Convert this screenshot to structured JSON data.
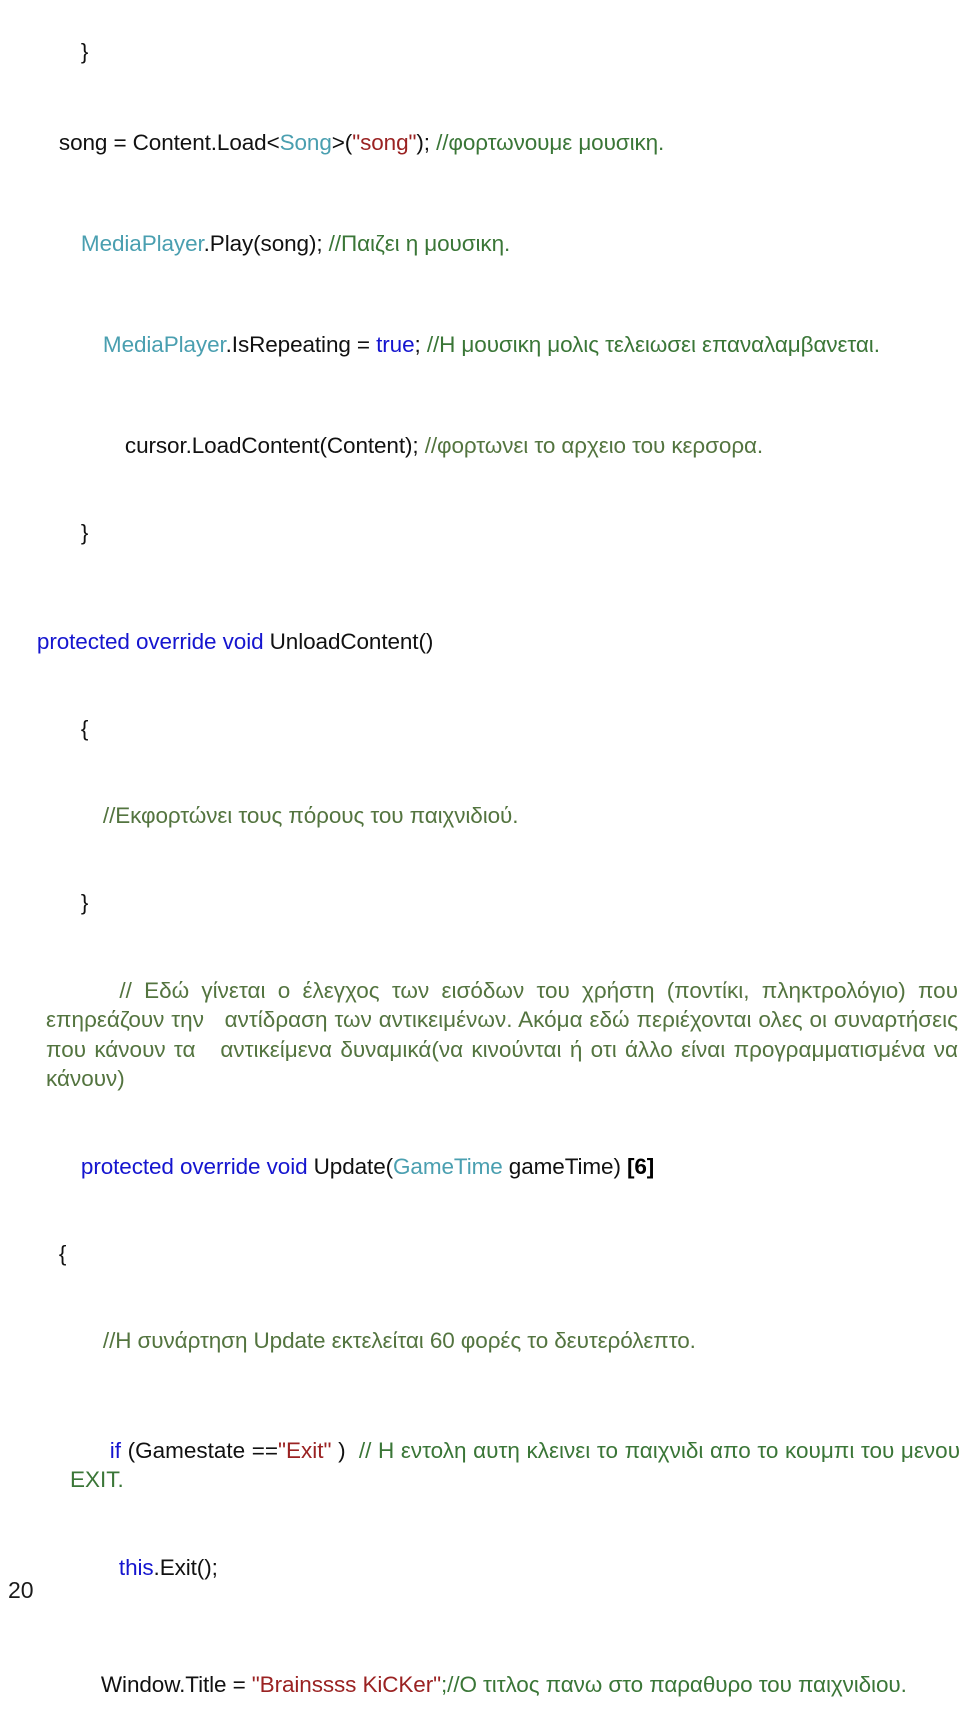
{
  "document": {
    "page_number": "20",
    "language": "C# (XNA) with Greek comments"
  },
  "colors": {
    "keyword": "#1515cf",
    "type": "#4a9fb0",
    "string": "#9a2222",
    "comment": "#3a7637",
    "comment_olive": "#53743f",
    "plain": "#111111",
    "background": "#ffffff"
  },
  "code": {
    "l01_brace_close": "}",
    "l02_a": "song = Content.Load<",
    "l02_b": "Song",
    "l02_c": ">(",
    "l02_d": "\"song\"",
    "l02_e": "); ",
    "l02_f": "//φορτωνουμε μουσικη.",
    "l03_a": "MediaPlayer",
    "l03_b": ".Play(song); ",
    "l03_c": "//Παιζει η μουσικη.",
    "l04_a": "MediaPlayer",
    "l04_b": ".IsRepeating = ",
    "l04_c": "true",
    "l04_d": "; ",
    "l04_e": "//Η μουσικη μολις τελειωσει επαναλαμβανεται.",
    "l05_a": "cursor.LoadContent(Content); ",
    "l05_b": "//φορτωνει το αρχειο του κερσορα.",
    "l06_brace_close": "}",
    "l07_a": "protected override void ",
    "l07_b": "UnloadContent()",
    "l08_brace_open": "{",
    "l09_comment": "//Εκφορτώνει τους πόρους του παιχνιδιού.",
    "l10_brace_close": "}",
    "l11_comment_block": "// Εδώ γίνεται ο έλεγχος των εισόδων του χρήστη (ποντίκι, πληκτρολόγιο) που επηρεάζουν την   αντίδραση των αντικειμένων. Ακόμα εδώ περιέχονται ολες οι συναρτήσεις που κάνουν τα   αντικείμενα δυναμικά(να κινούνται ή οτι άλλο είναι προγραμματισμένα να κάνουν)",
    "l12_a": "protected override void ",
    "l12_b": "Update(",
    "l12_c": "GameTime",
    "l12_d": " gameTime) ",
    "l12_e": "[6]",
    "l13_brace_open": "{",
    "l14_comment": "//Η συνάρτηση Update εκτελείται 60 φορές το δευτερόλεπτο.",
    "l15_a": "if ",
    "l15_b": "(Gamestate ==",
    "l15_c": "\"Exit\"",
    "l15_d": " )  ",
    "l15_e": "// Η εντολη αυτη κλεινει το παιχνιδι απο το κουμπι του μενου EXIT.",
    "l16_a": "this",
    "l16_b": ".Exit();",
    "l17_a": "Window.Title = ",
    "l17_b": "\"Brainssss KiCKer\"",
    "l17_c": ";//Ο τιτλος πανω στο παραθυρο του παιχνιδιου."
  }
}
